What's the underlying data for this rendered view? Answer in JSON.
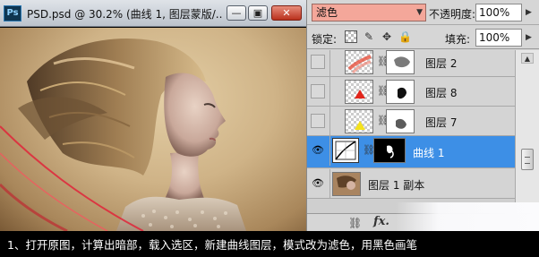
{
  "window": {
    "app_icon": "Ps",
    "title": "PSD.psd @ 30.2% (曲线 1, 图层蒙版/...",
    "buttons": {
      "minimize": "—",
      "maximize": "▣",
      "close": "✕"
    }
  },
  "layers_panel": {
    "blend_mode": "滤色",
    "opacity_label": "不透明度:",
    "opacity_value": "100%",
    "lock_label": "锁定:",
    "fill_label": "填充:",
    "fill_value": "100%",
    "layers": [
      {
        "name": "图层 2",
        "visible": false,
        "selected": false,
        "icon": "layer-thumbnail"
      },
      {
        "name": "图层 8",
        "visible": false,
        "selected": false,
        "icon": "layer-thumbnail"
      },
      {
        "name": "图层 7",
        "visible": false,
        "selected": false,
        "icon": "layer-thumbnail"
      },
      {
        "name": "曲线 1",
        "visible": true,
        "selected": true,
        "icon": "curves-adjustment-icon"
      },
      {
        "name": "图层 1 副本",
        "visible": true,
        "selected": false,
        "icon": "layer-thumbnail"
      }
    ],
    "footer_icons": [
      "link-icon",
      "fx-icon"
    ],
    "footer_fx": "fx."
  },
  "caption": "1、打开原图，计算出暗部，载入选区，新建曲线图层，模式改为滤色，用黑色画笔",
  "colors": {
    "blend_highlight": "#f4a79a",
    "selected_layer": "#3d8fe6",
    "panel_bg": "#d6d6d6"
  }
}
